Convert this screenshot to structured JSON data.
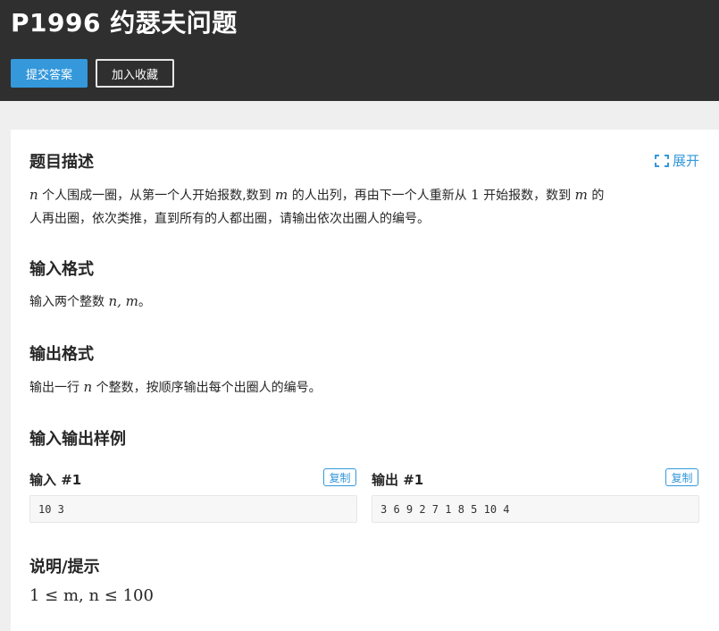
{
  "header": {
    "title": "P1996 约瑟夫问题",
    "submit_label": "提交答案",
    "favorite_label": "加入收藏"
  },
  "description": {
    "heading": "题目描述",
    "expand_label": "展开",
    "expand_icon": "expand-corners-icon",
    "line1_a": "个人围成一圈，从第一个人开始报数,数到",
    "line1_b": "的人出列，再由下一个人重新从",
    "line1_c": "开始报数，数到",
    "line1_d": "的",
    "line2": "人再出圈，依次类推，直到所有的人都出圈，请输出依次出圈人的编号。",
    "var_n": "n",
    "var_m": "m",
    "num_1": "1"
  },
  "input_format": {
    "heading": "输入格式",
    "text": "输入两个整数",
    "math": "n, m",
    "end": "。"
  },
  "output_format": {
    "heading": "输出格式",
    "text_a": "输出一行",
    "var_n": "n",
    "text_b": "个整数，按顺序输出每个出圈人的编号。"
  },
  "samples": {
    "heading": "输入输出样例",
    "input_label": "输入 #1",
    "output_label": "输出 #1",
    "copy_label": "复制",
    "input_value": "10 3",
    "output_value": "3 6 9 2 7 1 8 5 10 4"
  },
  "hint": {
    "heading": "说明/提示",
    "math": "1 ≤ m, n ≤ 100"
  },
  "colors": {
    "header_bg": "#2f2f2f",
    "accent": "#3498db",
    "page_bg": "#efefef"
  }
}
